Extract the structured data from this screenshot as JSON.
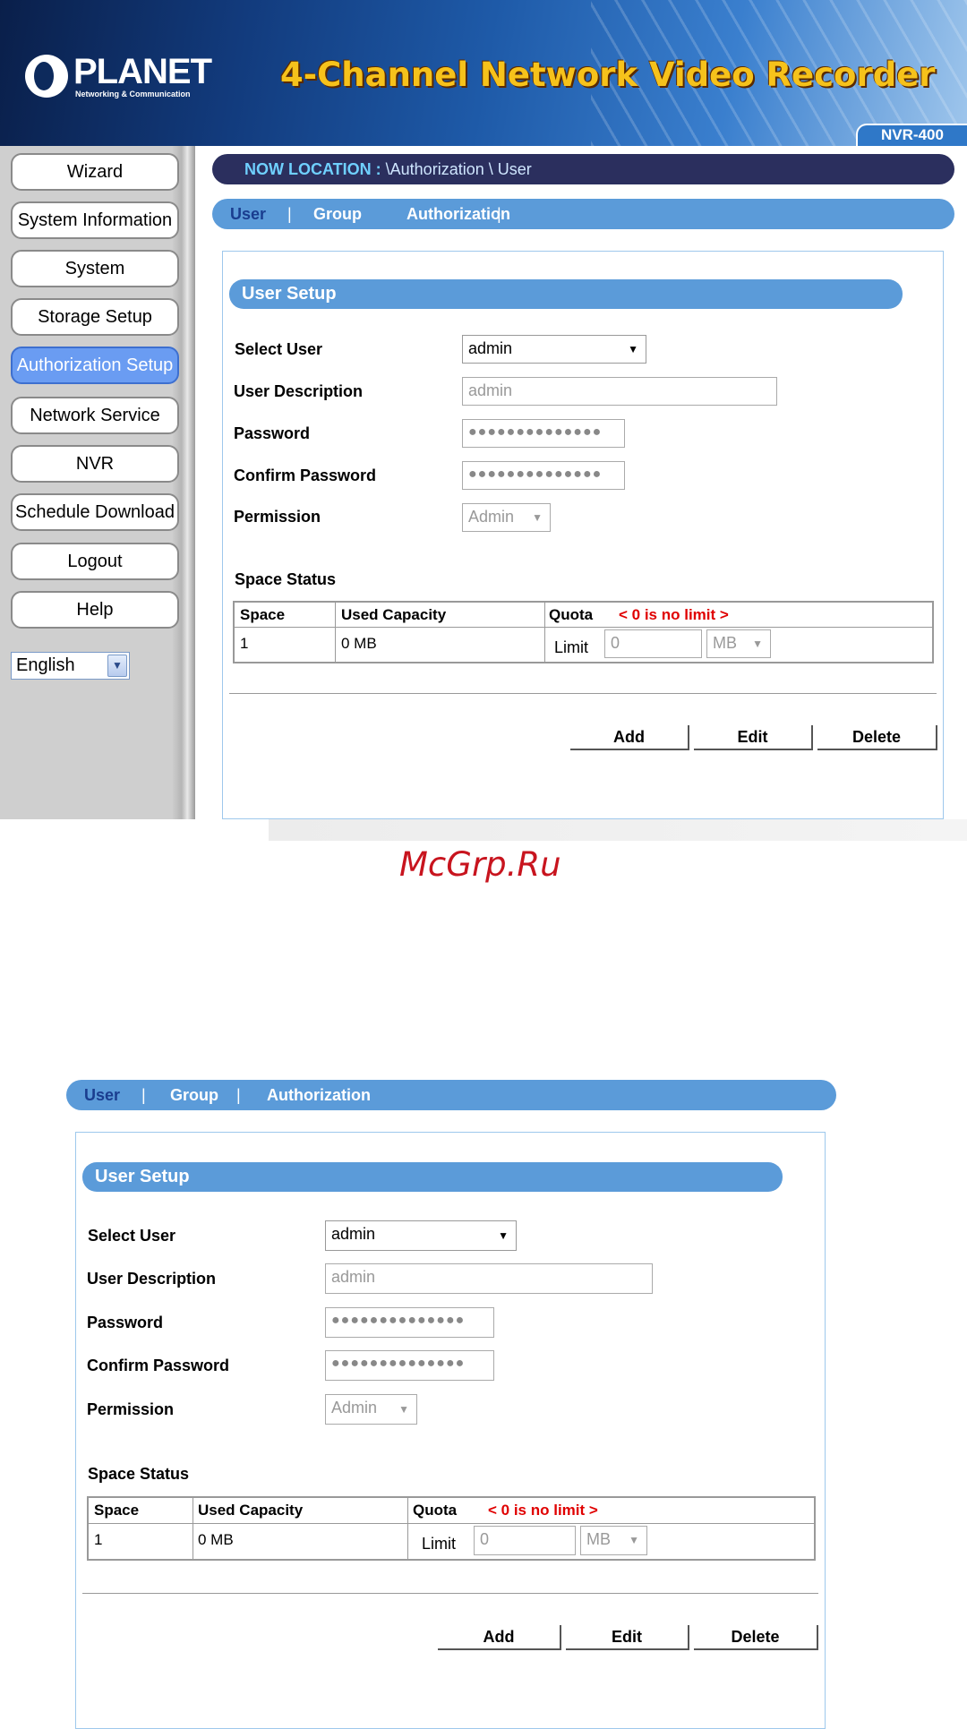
{
  "header": {
    "brand": "PLANET",
    "brand_sub": "Networking & Communication",
    "title": "4-Channel Network Video Recorder",
    "model": "NVR-400"
  },
  "sidebar": {
    "items": [
      {
        "label": "Wizard"
      },
      {
        "label": "System Information"
      },
      {
        "label": "System"
      },
      {
        "label": "Storage Setup"
      },
      {
        "label": "Authorization Setup"
      },
      {
        "label": "Network Service"
      },
      {
        "label": "NVR"
      },
      {
        "label": "Schedule Download"
      },
      {
        "label": "Logout"
      },
      {
        "label": "Help"
      }
    ],
    "active_index": 4,
    "language": "English"
  },
  "location": {
    "label": "NOW LOCATION :",
    "path": "\\Authorization \\ User"
  },
  "tabs": [
    {
      "label": "User"
    },
    {
      "label": "Group"
    },
    {
      "label": "Authorization"
    }
  ],
  "tab_separator": "|",
  "form": {
    "section_title": "User Setup",
    "select_user_label": "Select User",
    "select_user_value": "admin",
    "description_label": "User Description",
    "description_value": "admin",
    "password_label": "Password",
    "password_value": "●●●●●●●●●●●●●●",
    "confirm_label": "Confirm Password",
    "confirm_value": "●●●●●●●●●●●●●●",
    "permission_label": "Permission",
    "permission_value": "Admin"
  },
  "space": {
    "title": "Space Status",
    "col_space": "Space",
    "col_used": "Used Capacity",
    "col_quota": "Quota",
    "quota_note": "< 0 is no limit >",
    "row_space": "1",
    "row_used": "0 MB",
    "limit_label": "Limit",
    "limit_value": "0",
    "unit_value": "MB"
  },
  "actions": {
    "add": "Add",
    "edit": "Edit",
    "delete": "Delete"
  },
  "watermark": "McGrp.Ru",
  "icons": {
    "dropdown": "▼",
    "dropdown_gray": "▼"
  },
  "colors": {
    "accent_blue": "#5b9bd9",
    "location_bar": "#2b2f5e",
    "active_nav": "#6a9cf2",
    "note_red": "#e00000"
  }
}
